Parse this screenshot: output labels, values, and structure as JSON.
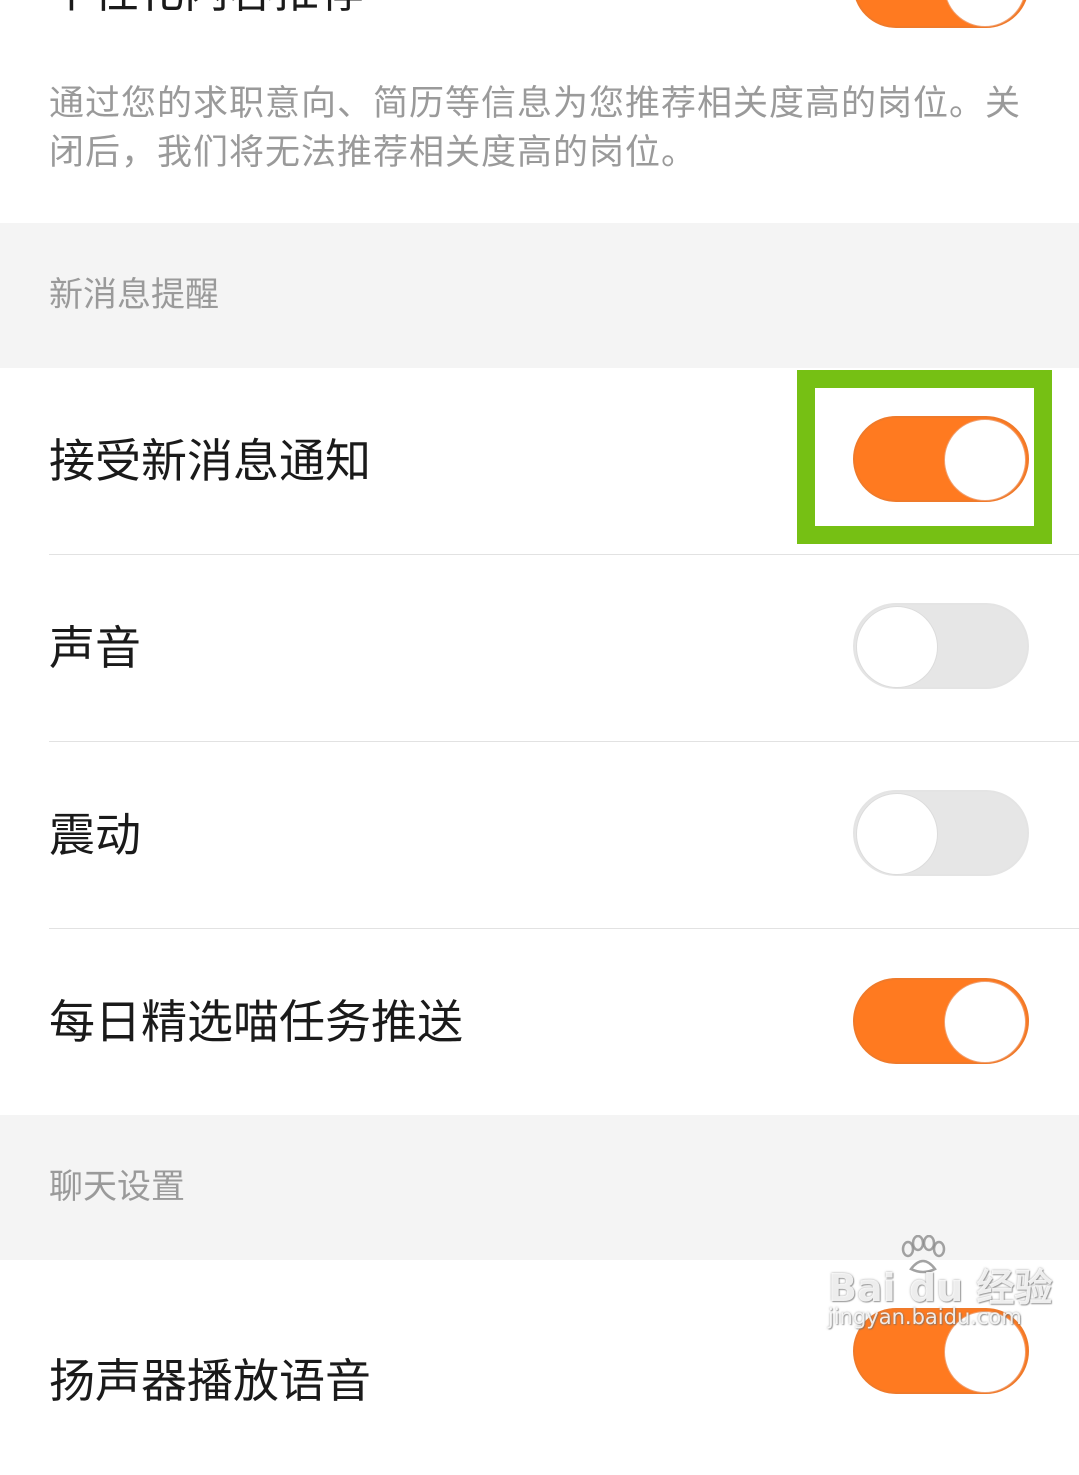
{
  "top_row": {
    "label": "个性化内容推荐",
    "enabled": true
  },
  "recommend_description": "通过您的求职意向、简历等信息为您推荐相关度高的岗位。关闭后，我们将无法推荐相关度高的岗位。",
  "sections": {
    "notifications": {
      "title": "新消息提醒",
      "items": [
        {
          "label": "接受新消息通知",
          "enabled": true
        },
        {
          "label": "声音",
          "enabled": false
        },
        {
          "label": "震动",
          "enabled": false
        },
        {
          "label": "每日精选喵任务推送",
          "enabled": true
        }
      ]
    },
    "chat": {
      "title": "聊天设置",
      "items": [
        {
          "label": "扬声器播放语音",
          "enabled": true
        }
      ]
    }
  },
  "colors": {
    "toggle_on": "#ff7a20",
    "toggle_off": "#e6e6e6",
    "highlight": "#76c014"
  },
  "watermark": {
    "main": "Bai du 经验",
    "sub": "jingyan.baidu.com"
  }
}
